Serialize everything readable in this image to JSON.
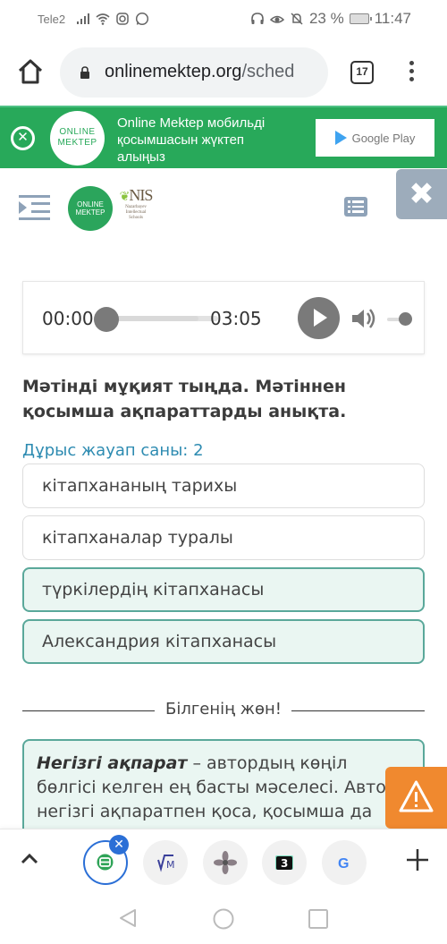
{
  "status_bar": {
    "carrier": "Tele2",
    "battery_percent": "23 %",
    "time": "11:47"
  },
  "browser": {
    "url_main": "onlinemektep.org",
    "url_rest": "/sched",
    "tab_count": "17"
  },
  "app_banner": {
    "logo_line1": "ONLINE",
    "logo_line2": "MEKTEP",
    "text": "Online Mektep мобильді қосымшасын жүктеп алыңыз",
    "store_label": "Google Play"
  },
  "header": {
    "logo_line1": "ONLINE",
    "logo_line2": "MEKTEP",
    "nis_title": "NIS",
    "nis_sub1": "Nazarbayev",
    "nis_sub2": "Intellectual",
    "nis_sub3": "Schools"
  },
  "audio": {
    "current_time": "00:00",
    "total_time": "03:05",
    "progress": 0,
    "volume": 1.0
  },
  "question": {
    "text": "Мәтінді мұқият тыңда. Мәтіннен қосымша ақпараттарды анықта.",
    "answer_count_label": "Дұрыс жауап саны: 2",
    "options": [
      {
        "label": "кітапхананың тарихы",
        "selected": false
      },
      {
        "label": "кітапханалар туралы",
        "selected": false
      },
      {
        "label": "түркілердің кітапханасы",
        "selected": true
      },
      {
        "label": "Александрия кітапханасы",
        "selected": true
      }
    ]
  },
  "tip": {
    "divider_label": "Білгенің жөн!",
    "term": "Негізгі ақпарат",
    "body": " – автордың көңіл бөлгісі келген ең басты мәселесі. Автор негізгі ақпаратпен қоса, қосымша да"
  },
  "colors": {
    "brand_green": "#28a95a",
    "accent_teal": "#5aa89a",
    "selected_bg": "#eaf6f2",
    "link_blue": "#2d8bb1",
    "warning_orange": "#f0892f",
    "tab_blue": "#2b6fd6"
  }
}
